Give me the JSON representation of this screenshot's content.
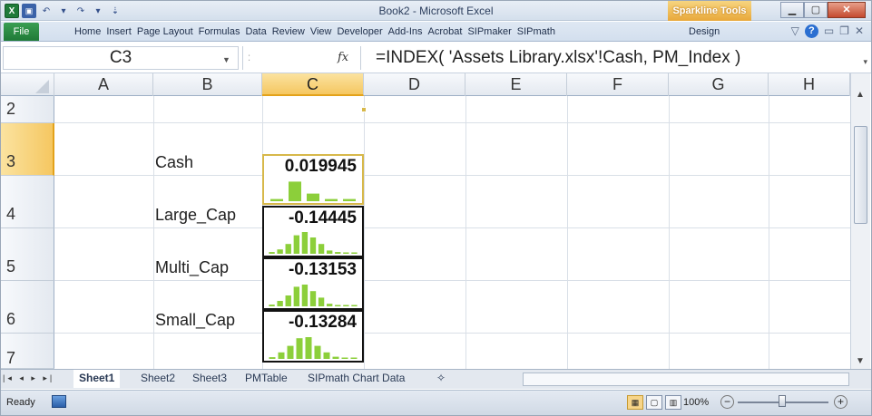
{
  "window": {
    "title": "Book2 - Microsoft Excel",
    "context_tab": "Sparkline Tools",
    "qat_icons": [
      "excel-logo-icon",
      "save-icon",
      "undo-icon",
      "redo-icon",
      "customize-icon"
    ]
  },
  "ribbon": {
    "file_tab": "File",
    "tabs": [
      "Home",
      "Insert",
      "Page Layout",
      "Formulas",
      "Data",
      "Review",
      "View",
      "Developer",
      "Add-Ins",
      "Acrobat",
      "SIPmaker",
      "SIPmath"
    ],
    "design_tab": "Design"
  },
  "formula_bar": {
    "name_box": "C3",
    "fx_label": "fx",
    "formula": "=INDEX( 'Assets Library.xlsx'!Cash, PM_Index )"
  },
  "columns": [
    "A",
    "B",
    "C",
    "D",
    "E",
    "F",
    "G",
    "H"
  ],
  "selected_column": "C",
  "rows": [
    {
      "num": "2",
      "label": "",
      "value": ""
    },
    {
      "num": "3",
      "label": "Cash",
      "value": "0.019945",
      "active": true,
      "spark": [
        0.1,
        0.9,
        0.35,
        0.1,
        0.1
      ]
    },
    {
      "num": "4",
      "label": "Large_Cap",
      "value": "-0.14445",
      "spark": [
        0.08,
        0.2,
        0.45,
        0.85,
        1.0,
        0.75,
        0.45,
        0.15,
        0.08,
        0.05,
        0.05
      ]
    },
    {
      "num": "5",
      "label": "Multi_Cap",
      "value": "-0.13153",
      "spark": [
        0.08,
        0.25,
        0.5,
        0.9,
        1.0,
        0.7,
        0.4,
        0.12,
        0.06,
        0.05,
        0.05
      ]
    },
    {
      "num": "6",
      "label": "Small_Cap",
      "value": "-0.13284",
      "spark": [
        0.08,
        0.3,
        0.6,
        0.95,
        1.0,
        0.6,
        0.3,
        0.1,
        0.05,
        0.05
      ]
    },
    {
      "num": "7",
      "label": "",
      "value": ""
    }
  ],
  "sheet_tabs": [
    "Sheet1",
    "Sheet2",
    "Sheet3",
    "PMTable",
    "SIPmath Chart Data"
  ],
  "active_sheet": "Sheet1",
  "status": {
    "ready": "Ready",
    "zoom": "100%"
  },
  "colors": {
    "spark_bar": "#8ccf3a",
    "selection_accent": "#f5c761"
  }
}
